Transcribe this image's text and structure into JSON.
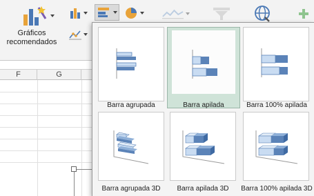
{
  "ribbon": {
    "recommended_label_line1": "Gráficos",
    "recommended_label_line2": "recomendados"
  },
  "sheet": {
    "columns": [
      "F",
      "G"
    ]
  },
  "bar_menu": {
    "options": [
      {
        "label": "Barra agrupada",
        "selected": false
      },
      {
        "label": "Barra apilada",
        "selected": true
      },
      {
        "label": "Barra 100% apilada",
        "selected": false
      },
      {
        "label": "Barra agrupada 3D",
        "selected": false
      },
      {
        "label": "Barra apilada 3D",
        "selected": false
      },
      {
        "label": "Barra 100% apilada 3D",
        "selected": false
      }
    ]
  },
  "colors": {
    "bar_dark": "#5b83b8",
    "bar_light": "#c9dcf2",
    "selection": "#cfe3d8"
  }
}
